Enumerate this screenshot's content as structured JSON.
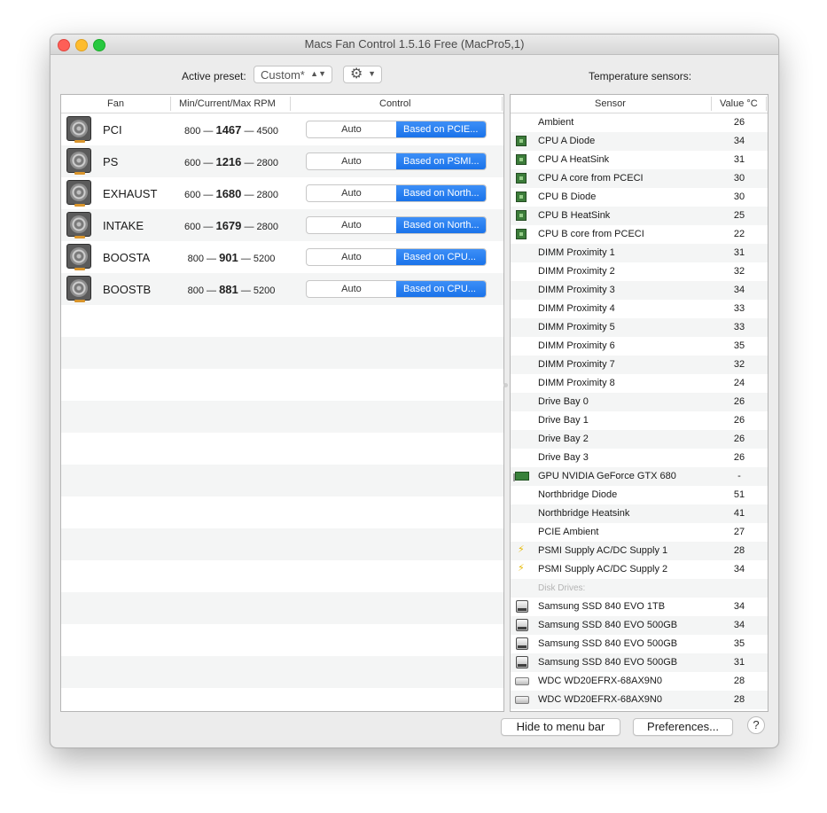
{
  "window": {
    "title": "Macs Fan Control 1.5.16 Free (MacPro5,1)"
  },
  "preset": {
    "label": "Active preset:",
    "value": "Custom*"
  },
  "fans": {
    "headers": {
      "fan": "Fan",
      "rpm": "Min/Current/Max RPM",
      "control": "Control"
    },
    "items": [
      {
        "name": "PCI",
        "min": "800",
        "current": "1467",
        "max": "4500",
        "auto": "Auto",
        "based": "Based on PCIE..."
      },
      {
        "name": "PS",
        "min": "600",
        "current": "1216",
        "max": "2800",
        "auto": "Auto",
        "based": "Based on PSMI..."
      },
      {
        "name": "EXHAUST",
        "min": "600",
        "current": "1680",
        "max": "2800",
        "auto": "Auto",
        "based": "Based on North..."
      },
      {
        "name": "INTAKE",
        "min": "600",
        "current": "1679",
        "max": "2800",
        "auto": "Auto",
        "based": "Based on North..."
      },
      {
        "name": "BOOSTA",
        "min": "800",
        "current": "901",
        "max": "5200",
        "auto": "Auto",
        "based": "Based on CPU..."
      },
      {
        "name": "BOOSTB",
        "min": "800",
        "current": "881",
        "max": "5200",
        "auto": "Auto",
        "based": "Based on CPU..."
      }
    ]
  },
  "sensors": {
    "title": "Temperature sensors:",
    "headers": {
      "sensor": "Sensor",
      "value": "Value °C"
    },
    "items": [
      {
        "icon": "none",
        "name": "Ambient",
        "value": "26"
      },
      {
        "icon": "cpu-chip-icon",
        "name": "CPU A Diode",
        "value": "34"
      },
      {
        "icon": "cpu-chip-icon",
        "name": "CPU A HeatSink",
        "value": "31"
      },
      {
        "icon": "cpu-chip-icon",
        "name": "CPU A core from PCECI",
        "value": "30"
      },
      {
        "icon": "cpu-chip-icon",
        "name": "CPU B Diode",
        "value": "30"
      },
      {
        "icon": "cpu-chip-icon",
        "name": "CPU B HeatSink",
        "value": "25"
      },
      {
        "icon": "cpu-chip-icon",
        "name": "CPU B core from PCECI",
        "value": "22"
      },
      {
        "icon": "none",
        "name": "DIMM Proximity 1",
        "value": "31"
      },
      {
        "icon": "none",
        "name": "DIMM Proximity 2",
        "value": "32"
      },
      {
        "icon": "none",
        "name": "DIMM Proximity 3",
        "value": "34"
      },
      {
        "icon": "none",
        "name": "DIMM Proximity 4",
        "value": "33"
      },
      {
        "icon": "none",
        "name": "DIMM Proximity 5",
        "value": "33"
      },
      {
        "icon": "none",
        "name": "DIMM Proximity 6",
        "value": "35"
      },
      {
        "icon": "none",
        "name": "DIMM Proximity 7",
        "value": "32"
      },
      {
        "icon": "none",
        "name": "DIMM Proximity 8",
        "value": "24"
      },
      {
        "icon": "none",
        "name": "Drive Bay 0",
        "value": "26"
      },
      {
        "icon": "none",
        "name": "Drive Bay 1",
        "value": "26"
      },
      {
        "icon": "none",
        "name": "Drive Bay 2",
        "value": "26"
      },
      {
        "icon": "none",
        "name": "Drive Bay 3",
        "value": "26"
      },
      {
        "icon": "gpu-card-icon",
        "name": "GPU NVIDIA GeForce GTX 680",
        "value": "-"
      },
      {
        "icon": "none",
        "name": "Northbridge Diode",
        "value": "51"
      },
      {
        "icon": "none",
        "name": "Northbridge Heatsink",
        "value": "41"
      },
      {
        "icon": "none",
        "name": "PCIE Ambient",
        "value": "27"
      },
      {
        "icon": "power-bolt-icon",
        "name": "PSMI Supply AC/DC Supply 1",
        "value": "28"
      },
      {
        "icon": "power-bolt-icon",
        "name": "PSMI Supply AC/DC Supply 2",
        "value": "34"
      },
      {
        "icon": "group",
        "name": "Disk Drives:",
        "value": ""
      },
      {
        "icon": "ssd-drive-icon",
        "name": "Samsung SSD 840 EVO 1TB",
        "value": "34"
      },
      {
        "icon": "ssd-drive-icon",
        "name": "Samsung SSD 840 EVO 500GB",
        "value": "34"
      },
      {
        "icon": "ssd-drive-icon",
        "name": "Samsung SSD 840 EVO 500GB",
        "value": "35"
      },
      {
        "icon": "ssd-drive-icon",
        "name": "Samsung SSD 840 EVO 500GB",
        "value": "31"
      },
      {
        "icon": "hdd-drive-icon",
        "name": "WDC WD20EFRX-68AX9N0",
        "value": "28"
      },
      {
        "icon": "hdd-drive-icon",
        "name": "WDC WD20EFRX-68AX9N0",
        "value": "28"
      }
    ]
  },
  "buttons": {
    "hide": "Hide to menu bar",
    "preferences": "Preferences...",
    "help": "?"
  },
  "colors": {
    "accent": "#1a73ea",
    "close": "#fe5f57",
    "minimize": "#febc2e",
    "maximize": "#28c840"
  }
}
